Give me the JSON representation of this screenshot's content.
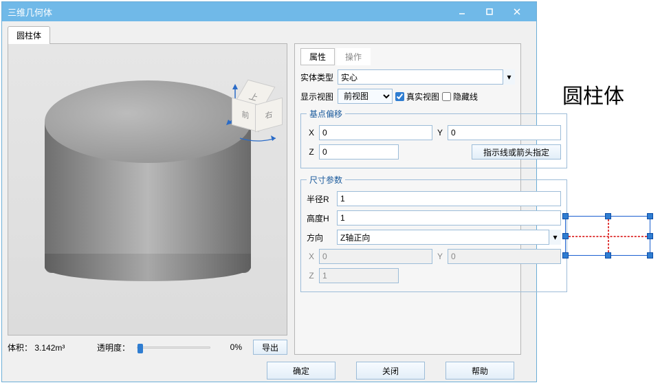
{
  "window": {
    "title": "三维几何体"
  },
  "tabs": {
    "main": "圆柱体"
  },
  "viewcube": {
    "top": "上",
    "front": "前",
    "right": "右"
  },
  "status": {
    "volume_label": "体积：",
    "volume_value": "3.142m³",
    "opacity_label": "透明度：",
    "opacity_value": "0%",
    "export": "导出"
  },
  "panel": {
    "tab_attr": "属性",
    "tab_op": "操作",
    "solid_type_label": "实体类型",
    "solid_type_value": "实心",
    "view_label": "显示视图",
    "view_value": "前视图",
    "real_view": "真实视图",
    "hidden_line": "隐藏线",
    "base_offset": "基点偏移",
    "x": "X",
    "y": "Y",
    "z": "Z",
    "base": {
      "x": "0",
      "y": "0",
      "z": "0"
    },
    "indicator_btn": "指示线或箭头指定",
    "dimensions": "尺寸参数",
    "radius_label": "半径R",
    "radius": "1",
    "height_label": "高度H",
    "height": "1",
    "direction_label": "方向",
    "direction": "Z轴正向",
    "dir": {
      "x": "0",
      "y": "0",
      "z": "1"
    }
  },
  "buttons": {
    "ok": "确定",
    "close": "关闭",
    "help": "帮助"
  },
  "external": {
    "text": "圆柱体"
  }
}
